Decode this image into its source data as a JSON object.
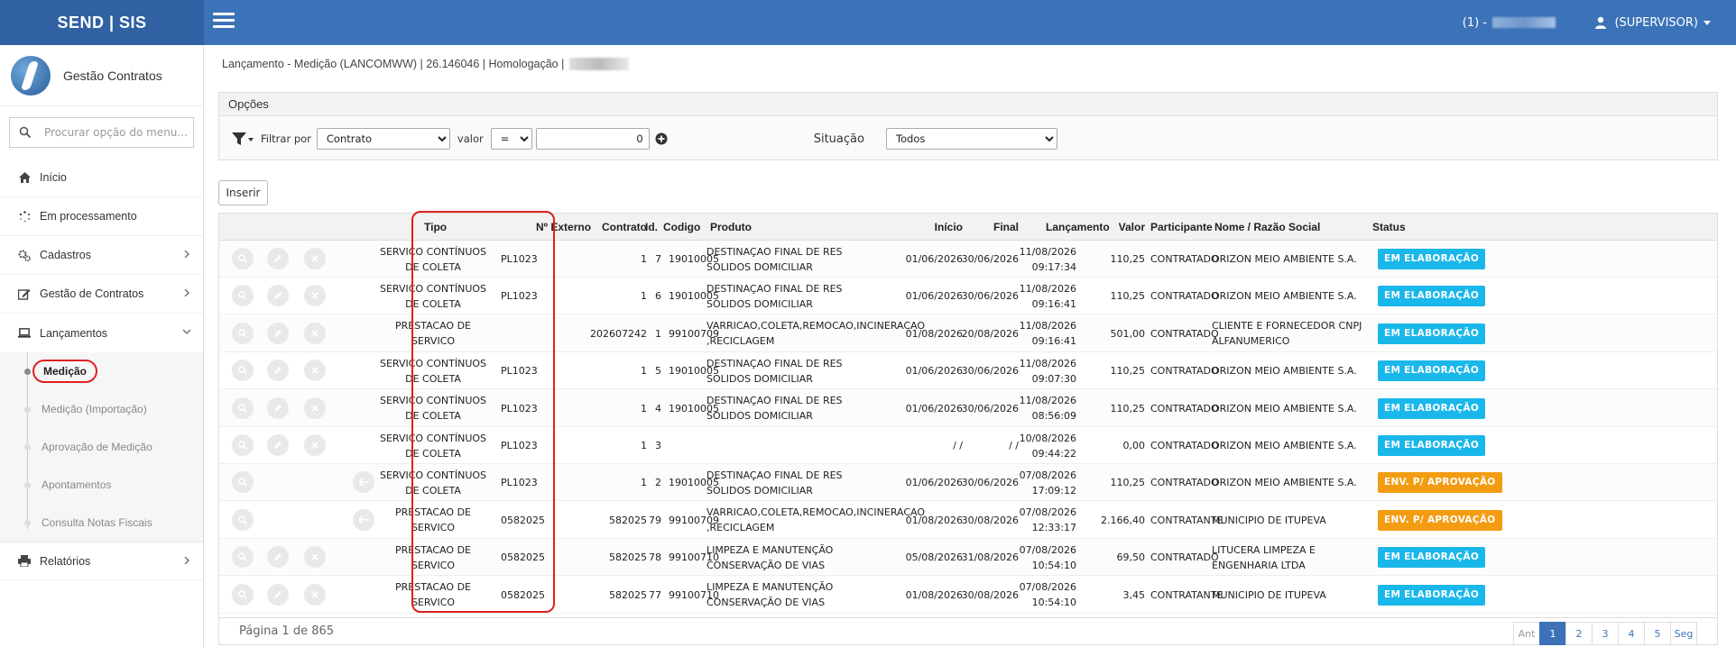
{
  "app": {
    "brand": "SEND | SIS",
    "module_title": "Gestão Contratos"
  },
  "topbar": {
    "session_label": "(1) -",
    "user_label": "(SUPERVISOR)"
  },
  "sidebar": {
    "search_placeholder": "Procurar opção do menu...",
    "items": [
      {
        "label": "Início",
        "icon": "home-icon"
      },
      {
        "label": "Em processamento",
        "icon": "spinner-icon"
      },
      {
        "label": "Cadastros",
        "icon": "gears-icon"
      },
      {
        "label": "Gestão de Contratos",
        "icon": "edit-icon"
      },
      {
        "label": "Lançamentos",
        "icon": "laptop-icon"
      },
      {
        "label": "Relatórios",
        "icon": "print-icon"
      }
    ],
    "sub_items": [
      "Medição",
      "Medição (Importação)",
      "Aprovação de Medição",
      "Apontamentos",
      "Consulta Notas Fiscais"
    ]
  },
  "breadcrumb": "Lançamento - Medição (LANCOMWW) | 26.146046 | Homologação |",
  "options": {
    "title": "Opções",
    "filter_label": "Filtrar por",
    "filter_value": "Contrato",
    "valor_label": "valor",
    "operator": "=",
    "value_input": "0",
    "situacao_label": "Situação",
    "situacao_value": "Todos"
  },
  "insert_button": "Inserir",
  "colors": {
    "accent": "#3c73b8",
    "elaboracao": "#1ab7ea",
    "aprovacao": "#f39c12"
  },
  "table": {
    "headers": {
      "tipo": "Tipo",
      "externo": "Nº Externo",
      "contrato": "Contrato",
      "id": "Id.",
      "codigo": "Codigo",
      "produto": "Produto",
      "inicio": "Início",
      "final": "Final",
      "lancamento": "Lançamento",
      "valor": "Valor",
      "participante": "Participante",
      "razao": "Nome / Razão Social",
      "status": "Status"
    },
    "rows": [
      {
        "tipo": "SERVIÇO CONTÍNUOS DE COLETA",
        "externo": "PL1023",
        "contrato": "1",
        "id": "7",
        "codigo": "19010005",
        "produto": "DESTINAÇAO FINAL DE RES SOLIDOS DOMICILIAR",
        "inicio": "01/06/2026",
        "final": "30/06/2026",
        "lanc_date": "11/08/2026",
        "lanc_time": "09:17:34",
        "valor": "110,25",
        "participante": "CONTRATADO",
        "razao": "ORIZON MEIO AMBIENTE S.A.",
        "status": "EM ELABORAÇÃO",
        "status_type": "elaboracao"
      },
      {
        "tipo": "SERVIÇO CONTÍNUOS DE COLETA",
        "externo": "PL1023",
        "contrato": "1",
        "id": "6",
        "codigo": "19010005",
        "produto": "DESTINAÇAO FINAL DE RES SOLIDOS DOMICILIAR",
        "inicio": "01/06/2026",
        "final": "30/06/2026",
        "lanc_date": "11/08/2026",
        "lanc_time": "09:16:41",
        "valor": "110,25",
        "participante": "CONTRATADO",
        "razao": "ORIZON MEIO AMBIENTE S.A.",
        "status": "EM ELABORAÇÃO",
        "status_type": "elaboracao"
      },
      {
        "tipo": "PRESTACAO DE SERVICO",
        "externo": "",
        "contrato": "202607242",
        "id": "1",
        "codigo": "99100709",
        "produto": "VARRICAO,COLETA,REMOCAO,INCINERACAO ,RECICLAGEM",
        "inicio": "01/08/2026",
        "final": "20/08/2026",
        "lanc_date": "11/08/2026",
        "lanc_time": "09:16:41",
        "valor": "501,00",
        "participante": "CONTRATADO",
        "razao": "CLIENTE E FORNECEDOR CNPJ ALFANUMERICO",
        "status": "EM ELABORAÇÃO",
        "status_type": "elaboracao"
      },
      {
        "tipo": "SERVIÇO CONTÍNUOS DE COLETA",
        "externo": "PL1023",
        "contrato": "1",
        "id": "5",
        "codigo": "19010005",
        "produto": "DESTINAÇAO FINAL DE RES SOLIDOS DOMICILIAR",
        "inicio": "01/06/2026",
        "final": "30/06/2026",
        "lanc_date": "11/08/2026",
        "lanc_time": "09:07:30",
        "valor": "110,25",
        "participante": "CONTRATADO",
        "razao": "ORIZON MEIO AMBIENTE S.A.",
        "status": "EM ELABORAÇÃO",
        "status_type": "elaboracao"
      },
      {
        "tipo": "SERVIÇO CONTÍNUOS DE COLETA",
        "externo": "PL1023",
        "contrato": "1",
        "id": "4",
        "codigo": "19010005",
        "produto": "DESTINAÇAO FINAL DE RES SOLIDOS DOMICILIAR",
        "inicio": "01/06/2026",
        "final": "30/06/2026",
        "lanc_date": "11/08/2026",
        "lanc_time": "08:56:09",
        "valor": "110,25",
        "participante": "CONTRATADO",
        "razao": "ORIZON MEIO AMBIENTE S.A.",
        "status": "EM ELABORAÇÃO",
        "status_type": "elaboracao"
      },
      {
        "tipo": "SERVIÇO CONTÍNUOS DE COLETA",
        "externo": "PL1023",
        "contrato": "1",
        "id": "3",
        "codigo": "",
        "produto": "",
        "inicio": "/ /",
        "final": "/ /",
        "lanc_date": "10/08/2026",
        "lanc_time": "09:44:22",
        "valor": "0,00",
        "participante": "CONTRATADO",
        "razao": "ORIZON MEIO AMBIENTE S.A.",
        "status": "EM ELABORAÇÃO",
        "status_type": "elaboracao"
      },
      {
        "tipo": "SERVIÇO CONTÍNUOS DE COLETA",
        "externo": "PL1023",
        "contrato": "1",
        "id": "2",
        "codigo": "19010005",
        "produto": "DESTINAÇAO FINAL DE RES SOLIDOS DOMICILIAR",
        "inicio": "01/06/2026",
        "final": "30/06/2026",
        "lanc_date": "07/08/2026",
        "lanc_time": "17:09:12",
        "valor": "110,25",
        "participante": "CONTRATADO",
        "razao": "ORIZON MEIO AMBIENTE S.A.",
        "status": "ENV. P/ APROVAÇÃO",
        "status_type": "aprovacao"
      },
      {
        "tipo": "PRESTACAO DE SERVICO",
        "externo": "0582025",
        "contrato": "582025",
        "id": "79",
        "codigo": "99100709",
        "produto": "VARRICAO,COLETA,REMOCAO,INCINERACAO ,RECICLAGEM",
        "inicio": "01/08/2026",
        "final": "30/08/2026",
        "lanc_date": "07/08/2026",
        "lanc_time": "12:33:17",
        "valor": "2.166,40",
        "participante": "CONTRATANTE",
        "razao": "MUNICIPIO DE ITUPEVA",
        "status": "ENV. P/ APROVAÇÃO",
        "status_type": "aprovacao"
      },
      {
        "tipo": "PRESTACAO DE SERVICO",
        "externo": "0582025",
        "contrato": "582025",
        "id": "78",
        "codigo": "99100710",
        "produto": "LIMPEZA E MANUTENÇÃO CONSERVAÇÃO DE VIAS",
        "inicio": "05/08/2026",
        "final": "31/08/2026",
        "lanc_date": "07/08/2026",
        "lanc_time": "10:54:10",
        "valor": "69,50",
        "participante": "CONTRATADO",
        "razao": "LITUCERA LIMPEZA E ENGENHARIA LTDA",
        "status": "EM ELABORAÇÃO",
        "status_type": "elaboracao"
      },
      {
        "tipo": "PRESTACAO DE SERVICO",
        "externo": "0582025",
        "contrato": "582025",
        "id": "77",
        "codigo": "99100710",
        "produto": "LIMPEZA E MANUTENÇÃO CONSERVAÇÃO DE VIAS",
        "inicio": "01/08/2026",
        "final": "30/08/2026",
        "lanc_date": "07/08/2026",
        "lanc_time": "10:54:10",
        "valor": "3,45",
        "participante": "CONTRATANTE",
        "razao": "MUNICIPIO DE ITUPEVA",
        "status": "EM ELABORAÇÃO",
        "status_type": "elaboracao"
      }
    ]
  },
  "pagination": {
    "label": "Página 1 de 865",
    "prev": "Ant",
    "pages": [
      "1",
      "2",
      "3",
      "4",
      "5"
    ],
    "next": "Seg"
  }
}
